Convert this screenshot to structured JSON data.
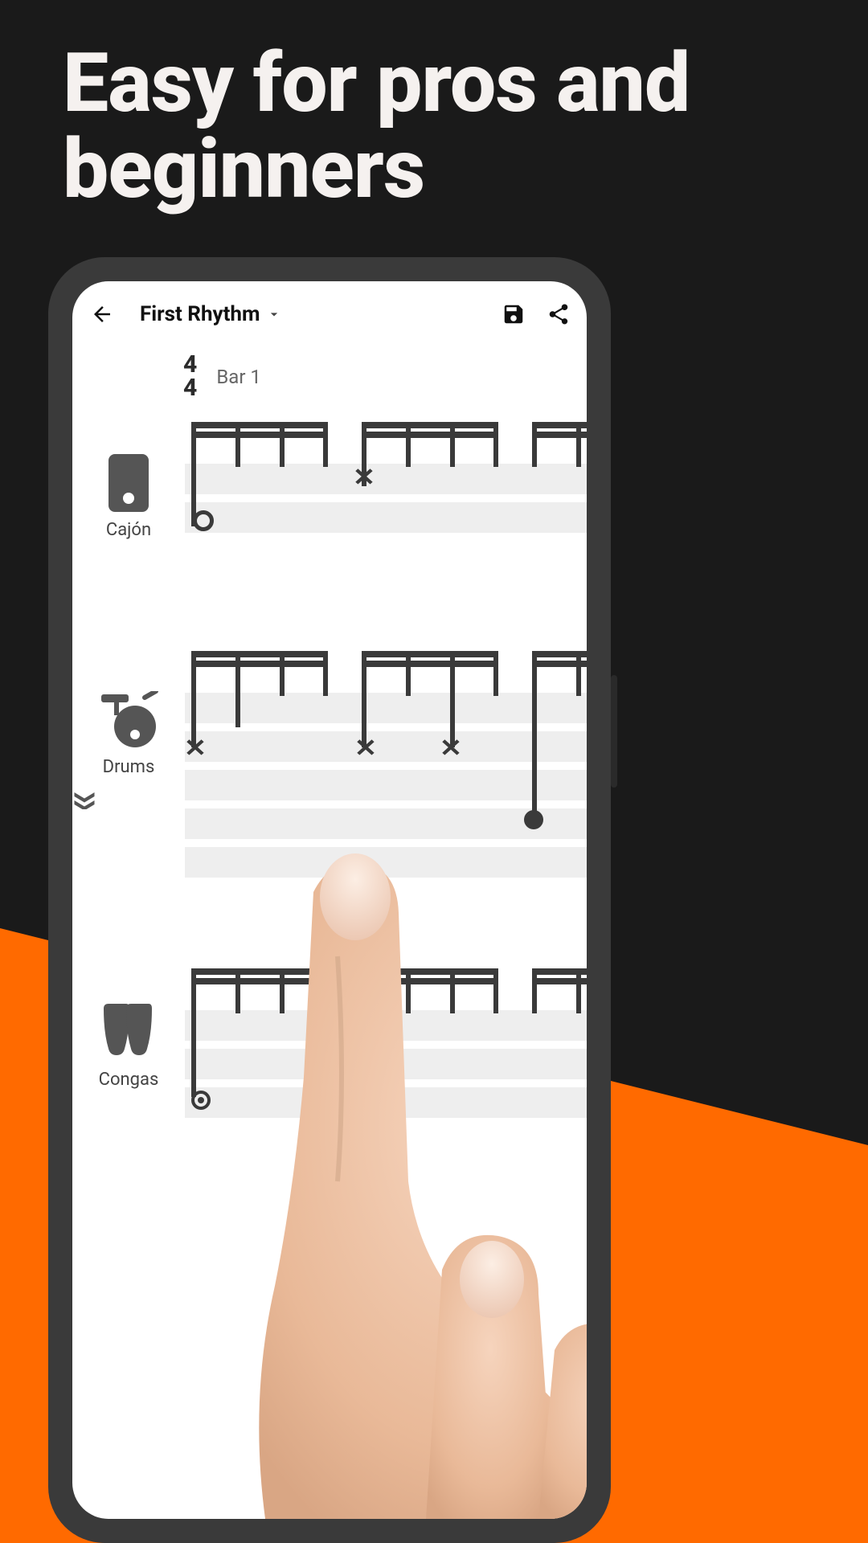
{
  "headline": "Easy for pros and beginners",
  "header": {
    "title": "First Rhythm"
  },
  "timesig": {
    "top": "4",
    "bottom": "4"
  },
  "bar_label": "Bar 1",
  "instruments": {
    "cajon": "Cajón",
    "drums": "Drums",
    "congas": "Congas"
  }
}
